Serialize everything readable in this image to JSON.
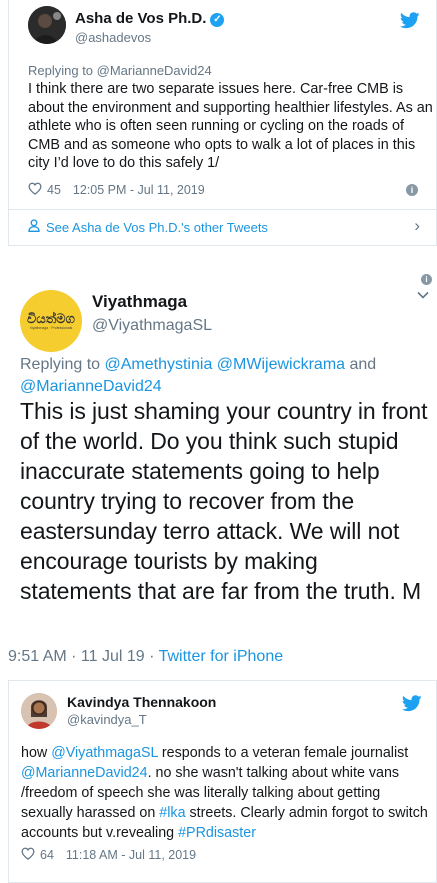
{
  "colors": {
    "twitter_blue": "#1da1f2",
    "link": "#1b95e0",
    "muted": "#657786",
    "text": "#14171a",
    "logo_yellow": "#f6cd2e"
  },
  "tweet1": {
    "name": "Asha de Vos Ph.D.",
    "handle": "@ashadevos",
    "replying_to": "Replying to @MarianneDavid24",
    "body": "I think there are two separate issues here. Car-free CMB is about the environment and supporting healthier lifestyles. As an athlete who is often seen running or cycling on the roads of CMB and as someone who opts to walk a lot of places in this city I’d love to do this safely 1/",
    "likes": "45",
    "time": "12:05 PM - Jul 11, 2019",
    "other_tweets_label": "See Asha de Vos Ph.D.'s other Tweets"
  },
  "tweet2": {
    "avatar_logo_text": "වියත්මග",
    "avatar_logo_sub": "Viyathmaga · Professionals",
    "name": "Viyathmaga",
    "handle": "@ViyathmagaSL",
    "replying_prefix": "Replying to",
    "mention_1": "@Amethystinia",
    "mention_2": "@MWijewickrama",
    "and_word": "and",
    "mention_3": "@MarianneDavid24",
    "body": "This is just shaming your country in front of the world. Do you think such stupid inaccurate statements going to help country trying to recover from the eastersunday terro attack. We will not encourage tourists by making statements that are far from the truth. M",
    "timestamp": "9:51 AM · 11 Jul 19 · ",
    "client": "Twitter for iPhone"
  },
  "tweet3": {
    "name": "Kavindya Thennakoon",
    "handle": "@kavindya_T",
    "body_1": "how ",
    "link_1": "@ViyathmagaSL",
    "body_2": " responds to a veteran female journalist ",
    "link_2": "@MarianneDavid24",
    "body_3": ". no she wasn't talking about white vans /freedom of speech she was literally talking about getting sexually harassed on ",
    "link_3": "#lka",
    "body_4": " streets. Clearly admin forgot to switch accounts but v.revealing ",
    "link_4": "#PRdisaster",
    "likes": "64",
    "time": "11:18 AM - Jul 11, 2019"
  }
}
